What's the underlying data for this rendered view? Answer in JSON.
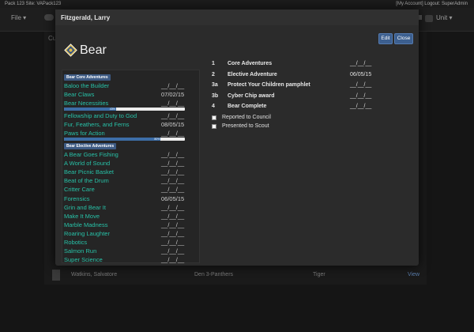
{
  "topbar": {
    "left": "Pack 123  Site: VAPack123",
    "right": "[My Account]   Logout: SuperAdmin"
  },
  "nav": {
    "file": "File ▾",
    "unit": "Unit ▾"
  },
  "background": {
    "cut_label": "Cu",
    "row": {
      "name": "Watkins, Salvatore",
      "den": "Den 3-Panthers",
      "rank": "Tiger",
      "action": "View"
    }
  },
  "modal": {
    "student_name": "Fitzgerald, Larry",
    "edit_label": "Edit",
    "close_label": "Close",
    "rank_title": "Bear"
  },
  "core_section_label": "Bear Core Adventures",
  "core_items": [
    {
      "name": "Baloo the Builder",
      "date": "__/__/__"
    },
    {
      "name": "Bear Claws",
      "date": "07/02/15"
    },
    {
      "name": "Bear Necessities",
      "date": "__/__/__",
      "progress_pct": 43
    },
    {
      "name": "Fellowship and Duty to God",
      "date": "__/__/__"
    },
    {
      "name": "Fur, Feathers, and Ferns",
      "date": "08/05/15"
    },
    {
      "name": "Paws for Action",
      "date": "__/__/__",
      "progress_pct": 80
    }
  ],
  "elective_section_label": "Bear Elective Adventures",
  "elective_items": [
    {
      "name": "A Bear Goes Fishing",
      "date": "__/__/__"
    },
    {
      "name": "A World of Sound",
      "date": "__/__/__"
    },
    {
      "name": "Bear Picnic Basket",
      "date": "__/__/__"
    },
    {
      "name": "Beat of the Drum",
      "date": "__/__/__"
    },
    {
      "name": "Critter Care",
      "date": "__/__/__"
    },
    {
      "name": "Forensics",
      "date": "06/05/15"
    },
    {
      "name": "Grin and Bear It",
      "date": "__/__/__"
    },
    {
      "name": "Make It Move",
      "date": "__/__/__"
    },
    {
      "name": "Marble Madness",
      "date": "__/__/__"
    },
    {
      "name": "Roaring Laughter",
      "date": "__/__/__"
    },
    {
      "name": "Robotics",
      "date": "__/__/__"
    },
    {
      "name": "Salmon Run",
      "date": "__/__/__"
    },
    {
      "name": "Super Science",
      "date": "__/__/__"
    }
  ],
  "requirements": [
    {
      "num": "1",
      "label": "Core Adventures",
      "date": "__/__/__"
    },
    {
      "num": "2",
      "label": "Elective Adventure",
      "date": "06/05/15"
    },
    {
      "num": "3a",
      "label": "Protect Your Children pamphlet",
      "date": "__/__/__"
    },
    {
      "num": "3b",
      "label": "Cyber Chip award",
      "date": "__/__/__"
    },
    {
      "num": "4",
      "label": "Bear Complete",
      "date": "__/__/__"
    }
  ],
  "checkboxes": [
    {
      "label": "Reported to Council"
    },
    {
      "label": "Presented to Scout"
    }
  ],
  "colors": {
    "link": "#27c1a7",
    "accent": "#3d5a83",
    "button": "#3c5f8f"
  }
}
